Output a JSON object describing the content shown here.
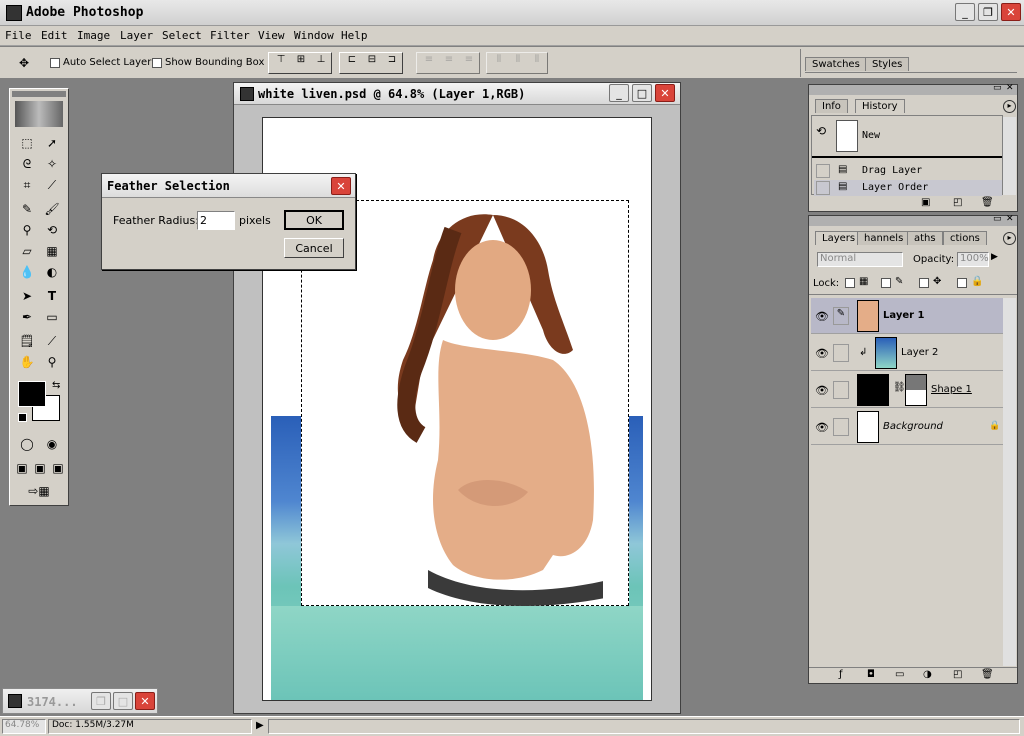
{
  "app": {
    "title": "Adobe Photoshop"
  },
  "menu": [
    "File",
    "Edit",
    "Image",
    "Layer",
    "Select",
    "Filter",
    "View",
    "Window",
    "Help"
  ],
  "options": {
    "auto_select_label": "Auto Select Layer",
    "bounding_box_label": "Show Bounding Box",
    "swatches_tab": "Swatches",
    "styles_tab": "Styles"
  },
  "document": {
    "title": "white liven.psd @ 64.8% (Layer 1,RGB)"
  },
  "dialog": {
    "title": "Feather Selection",
    "radius_label": "Feather Radius:",
    "radius_value": "2",
    "unit": "pixels",
    "ok_label": "OK",
    "cancel_label": "Cancel"
  },
  "history_panel": {
    "tabs": [
      "Info",
      "History"
    ],
    "snapshot_label": "New",
    "items": [
      "Drag Layer",
      "Layer Order"
    ]
  },
  "layers_panel": {
    "tabs": [
      "Layers",
      "Channels",
      "Paths",
      "Actions"
    ],
    "tab_display": [
      "Layers",
      "hannels",
      "aths",
      "ctions"
    ],
    "blend_mode": "Normal",
    "opacity_label": "Opacity:",
    "opacity_value": "100%",
    "lock_label": "Lock:",
    "layers": [
      {
        "name": "Layer 1",
        "selected": true
      },
      {
        "name": "Layer 2",
        "selected": false
      },
      {
        "name": "Shape 1",
        "selected": false
      },
      {
        "name": "Background",
        "selected": false
      }
    ]
  },
  "minimized": {
    "label": "3174..."
  },
  "status": {
    "zoom": "64.78%",
    "doc": "Doc: 1.55M/3.27M"
  },
  "colors": {
    "accent": "#d9443a",
    "layer_selected": "#b8b8c8",
    "water": "#6cc4b8",
    "sky": "#2a5fb8"
  }
}
